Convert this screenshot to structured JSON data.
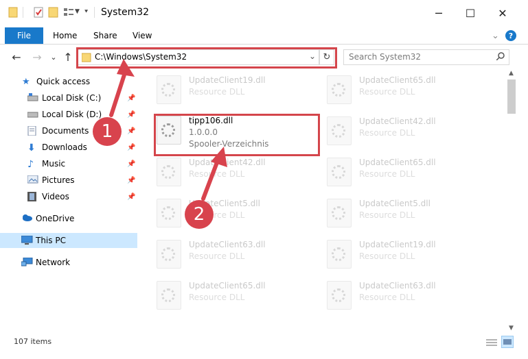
{
  "window": {
    "title": "System32",
    "controls": {
      "minimize": "─",
      "maximize": "☐",
      "close": "✕"
    }
  },
  "ribbon": {
    "tabs": [
      "File",
      "Home",
      "Share",
      "View"
    ],
    "expand": "⌄",
    "help": "?"
  },
  "nav": {
    "back": "←",
    "forward": "→",
    "recent": "⌄",
    "up": "↑",
    "address": "C:\\Windows\\System32",
    "address_dropdown": "⌄",
    "refresh": "↻",
    "search_placeholder": "Search System32"
  },
  "sidebar": {
    "items": [
      {
        "label": "Quick access",
        "icon": "star-icon",
        "pinned": false
      },
      {
        "label": "Local Disk (C:)",
        "icon": "drive-icon",
        "pinned": true
      },
      {
        "label": "Local Disk (D:)",
        "icon": "drive-icon",
        "pinned": true
      },
      {
        "label": "Documents",
        "icon": "documents-icon",
        "pinned": true
      },
      {
        "label": "Downloads",
        "icon": "download-icon",
        "pinned": true
      },
      {
        "label": "Music",
        "icon": "music-icon",
        "pinned": true
      },
      {
        "label": "Pictures",
        "icon": "pictures-icon",
        "pinned": true
      },
      {
        "label": "Videos",
        "icon": "videos-icon",
        "pinned": true
      },
      {
        "label": "OneDrive",
        "icon": "cloud-icon",
        "pinned": false
      },
      {
        "label": "This PC",
        "icon": "computer-icon",
        "pinned": false,
        "selected": true
      },
      {
        "label": "Network",
        "icon": "network-icon",
        "pinned": false
      }
    ],
    "pin_glyph": "📌"
  },
  "files": {
    "left": [
      {
        "name": "UpdateClient19.dll",
        "desc": "Resource DLL"
      },
      {
        "name": "tipp106.dll",
        "version": "1.0.0.0",
        "desc": "Spooler-Verzeichnis",
        "highlighted": true
      },
      {
        "name": "UpdateClient42.dll",
        "desc": "Resource DLL"
      },
      {
        "name": "UpdateClient5.dll",
        "desc": "Resource DLL"
      },
      {
        "name": "UpdateClient63.dll",
        "desc": "Resource DLL"
      },
      {
        "name": "UpdateClient65.dll",
        "desc": "Resource DLL"
      }
    ],
    "right": [
      {
        "name": "UpdateClient65.dll",
        "desc": "Resource DLL"
      },
      {
        "name": "UpdateClient42.dll",
        "desc": "Resource DLL"
      },
      {
        "name": "UpdateClient65.dll",
        "desc": "Resource DLL"
      },
      {
        "name": "UpdateClient5.dll",
        "desc": "Resource DLL"
      },
      {
        "name": "UpdateClient19.dll",
        "desc": "Resource DLL"
      },
      {
        "name": "UpdateClient63.dll",
        "desc": "Resource DLL"
      }
    ]
  },
  "status": {
    "count": "107 items"
  },
  "annotations": {
    "step1": "1",
    "step2": "2"
  },
  "colors": {
    "accent": "#1979ca",
    "highlight": "#d4454b",
    "badge": "#d8434d",
    "selected": "#cce8ff"
  }
}
